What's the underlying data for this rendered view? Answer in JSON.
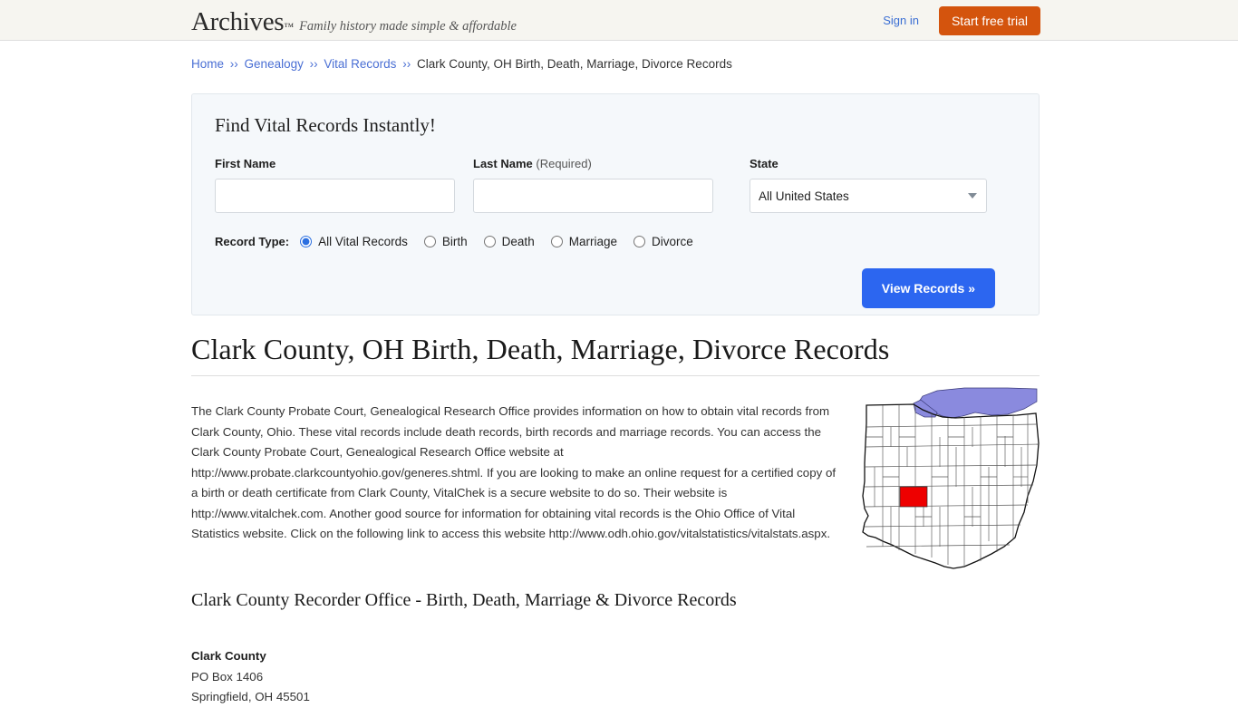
{
  "header": {
    "brand": "Archives",
    "brand_tm": "™",
    "tagline": "Family history made simple & affordable",
    "signin_label": "Sign in",
    "trial_label": "Start free trial",
    "background_color": "#f6f5f0",
    "trial_button_color": "#d4540d",
    "link_color": "#3b6fd4"
  },
  "breadcrumb": {
    "items": [
      {
        "label": "Home",
        "link": true
      },
      {
        "label": "Genealogy",
        "link": true
      },
      {
        "label": "Vital Records",
        "link": true
      },
      {
        "label": "Clark County, OH Birth, Death, Marriage, Divorce Records",
        "link": false
      }
    ],
    "separator": "››"
  },
  "search_panel": {
    "title": "Find Vital Records Instantly!",
    "first_name": {
      "label": "First Name",
      "value": "",
      "placeholder": ""
    },
    "last_name": {
      "label": "Last Name",
      "required_note": "(Required)",
      "value": "",
      "placeholder": ""
    },
    "state": {
      "label": "State",
      "selected": "All United States",
      "options": [
        "All United States"
      ]
    },
    "record_type": {
      "label": "Record Type:",
      "options": [
        {
          "label": "All Vital Records",
          "selected": true
        },
        {
          "label": "Birth",
          "selected": false
        },
        {
          "label": "Death",
          "selected": false
        },
        {
          "label": "Marriage",
          "selected": false
        },
        {
          "label": "Divorce",
          "selected": false
        }
      ]
    },
    "submit_label": "View Records »",
    "submit_color": "#2c66f0",
    "background_color": "#f5f8fb"
  },
  "main": {
    "page_title": "Clark County, OH Birth, Death, Marriage, Divorce Records",
    "intro_paragraph": "The Clark County Probate Court, Genealogical Research Office provides information on how to obtain vital records from Clark County, Ohio. These vital records include death records, birth records and marriage records. You can access the Clark County Probate Court, Genealogical Research Office website at http://www.probate.clarkcountyohio.gov/generes.shtml. If you are looking to make an online request for a certified copy of a birth or death certificate from Clark County, VitalChek is a secure website to do so. Their website is http://www.vitalchek.com. Another good source for information for obtaining vital records is the Ohio Office of Vital Statistics website. Click on the following link to access this website http://www.odh.ohio.gov/vitalstatistics/vitalstats.aspx.",
    "section_heading": "Clark County Recorder Office - Birth, Death, Marriage & Divorce Records",
    "address": {
      "name": "Clark County",
      "line1": "PO Box 1406",
      "line2": "Springfield, OH 45501"
    },
    "map": {
      "alt": "Map of Ohio with Clark County highlighted",
      "highlight_color": "#ee0000",
      "lake_color": "#8a8ade",
      "county_outline_color": "#555555",
      "state_outline_color": "#111111"
    }
  }
}
